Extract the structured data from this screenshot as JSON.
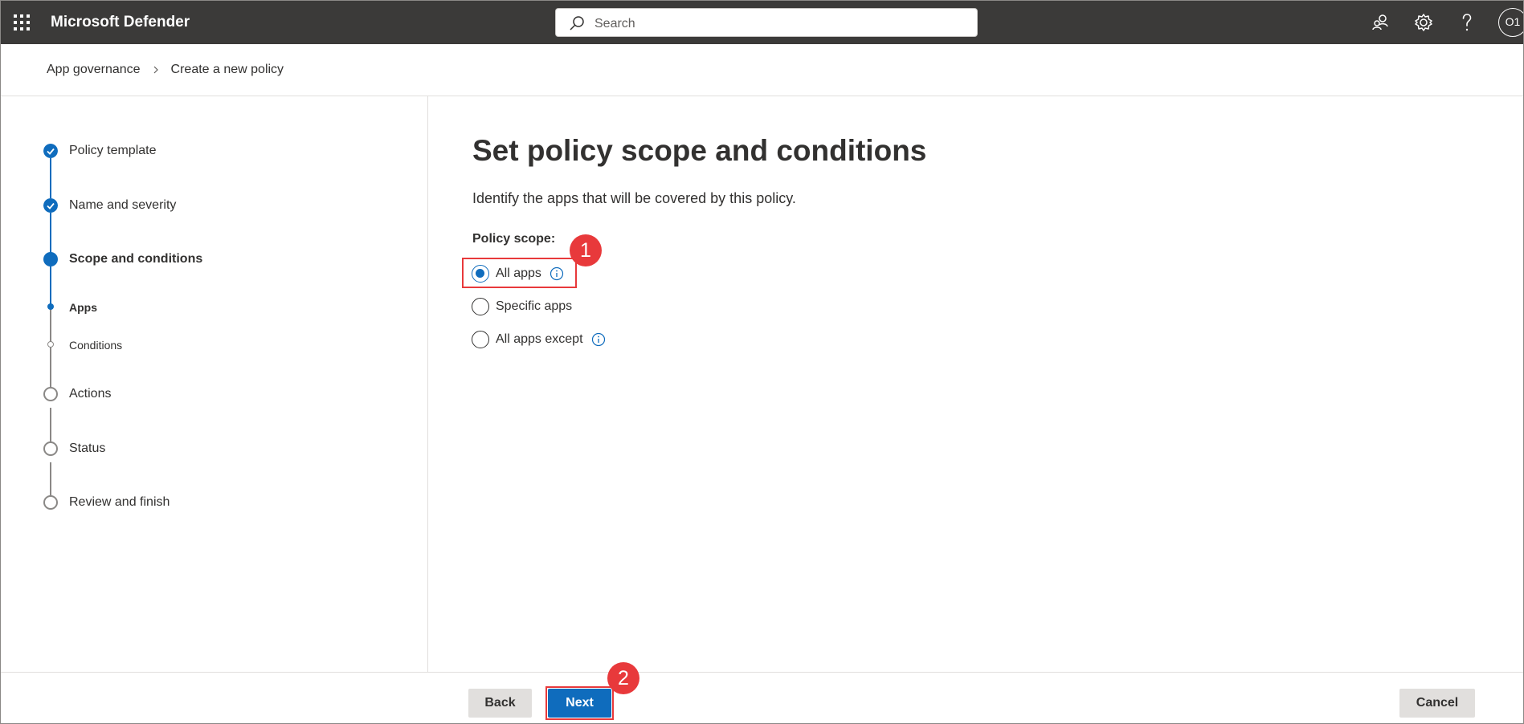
{
  "header": {
    "app_title": "Microsoft Defender",
    "search_placeholder": "Search",
    "avatar_initials": "O1",
    "icons": [
      "waffle-icon",
      "search-icon",
      "community-icon",
      "gear-icon",
      "help-icon"
    ]
  },
  "breadcrumb": {
    "items": [
      "App governance",
      "Create a new policy"
    ]
  },
  "steps": [
    {
      "label": "Policy template",
      "state": "completed"
    },
    {
      "label": "Name and severity",
      "state": "completed"
    },
    {
      "label": "Scope and conditions",
      "state": "current"
    },
    {
      "label": "Apps",
      "state": "current-substep"
    },
    {
      "label": "Conditions",
      "state": "pending-substep"
    },
    {
      "label": "Actions",
      "state": "pending"
    },
    {
      "label": "Status",
      "state": "pending"
    },
    {
      "label": "Review and finish",
      "state": "pending"
    }
  ],
  "main": {
    "title": "Set policy scope and conditions",
    "description": "Identify the apps that will be covered by this policy.",
    "scope_label": "Policy scope:",
    "options": [
      {
        "label": "All apps",
        "checked": true,
        "has_info": true
      },
      {
        "label": "Specific apps",
        "checked": false,
        "has_info": false
      },
      {
        "label": "All apps except",
        "checked": false,
        "has_info": true
      }
    ]
  },
  "callouts": [
    "1",
    "2"
  ],
  "footer": {
    "back_label": "Back",
    "next_label": "Next",
    "cancel_label": "Cancel"
  },
  "colors": {
    "topbar": "#3b3a39",
    "accent": "#0f6cbd",
    "highlight": "#e8393b",
    "secondary_button": "#e1dfdd"
  }
}
